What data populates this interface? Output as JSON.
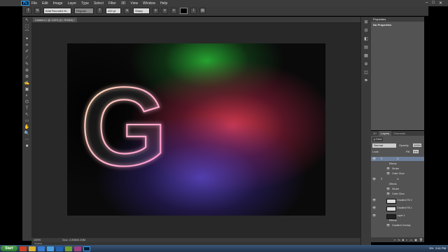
{
  "app": {
    "logo": "Ps",
    "menus": [
      "File",
      "Edit",
      "Image",
      "Layer",
      "Type",
      "Select",
      "Filter",
      "3D",
      "View",
      "Window",
      "Help"
    ]
  },
  "window_controls": [
    "–",
    "□",
    "✕"
  ],
  "options_bar": {
    "tool_glyph": "T",
    "font_family": "Arial Rounded M...",
    "font_style": "Regular",
    "font_size": "400 pt",
    "antialias": "Sharp",
    "align_icons": [
      "≡",
      "≡",
      "≡"
    ],
    "color_label": "color"
  },
  "tools": [
    "↖",
    "⬚",
    "⌒",
    "✦",
    "⌗",
    "✐",
    "⟋",
    "✎",
    "⊕",
    "⚙",
    "✍",
    "▣",
    "◐",
    "⌬",
    "T",
    "↖",
    "▭",
    "✋",
    "🔍",
    "⋯",
    "■"
  ],
  "document": {
    "tab_title": "Untitled-1 @ 100% (G, RGB/8) *",
    "letter": "G"
  },
  "status": {
    "zoom": "100%",
    "doc_info": "Doc: 2.20M/2.20M"
  },
  "timeline": {
    "label": "Timeline"
  },
  "panel_icons": [
    "⊞",
    "⊟",
    "◧",
    "▤",
    "▦",
    "⊕",
    "◫",
    "⚑"
  ],
  "properties": {
    "tab": "Properties",
    "subtitle": "No Properties"
  },
  "layers": {
    "tabs": [
      "3D",
      "Layers",
      "Channels"
    ],
    "kind": "ρ Kind",
    "blend": "Normal",
    "opacity_label": "Opacity:",
    "opacity": "100%",
    "lock_label": "Lock:",
    "fill_label": "Fill:",
    "fill": "0%",
    "rows": [
      {
        "eye": "👁",
        "label": "T",
        "name": "G",
        "selected": true
      },
      {
        "eye": "",
        "label": "",
        "name": "Effects"
      },
      {
        "eye": "👁",
        "label": "",
        "name": "Stroke"
      },
      {
        "eye": "👁",
        "label": "",
        "name": "Outer Glow"
      },
      {
        "eye": "👁",
        "label": "T",
        "name": "G"
      },
      {
        "eye": "",
        "label": "",
        "name": "Effects"
      },
      {
        "eye": "👁",
        "label": "",
        "name": "Stroke"
      },
      {
        "eye": "👁",
        "label": "",
        "name": "Outer Glow"
      },
      {
        "eye": "👁",
        "label": "",
        "name": "Gradient Fill 2"
      },
      {
        "eye": "👁",
        "label": "",
        "name": "Gradient Fill 1"
      },
      {
        "eye": "👁",
        "label": "",
        "name": "Layer 1"
      },
      {
        "eye": "",
        "label": "",
        "name": "Effects"
      },
      {
        "eye": "👁",
        "label": "",
        "name": "Gradient Overlay"
      }
    ],
    "footer_icons": [
      "∞",
      "fx",
      "◙",
      "◐",
      "▭",
      "▣",
      "🗑"
    ]
  },
  "taskbar": {
    "start": "Start",
    "tray_lang": "EN",
    "time": "2:41 PM"
  }
}
